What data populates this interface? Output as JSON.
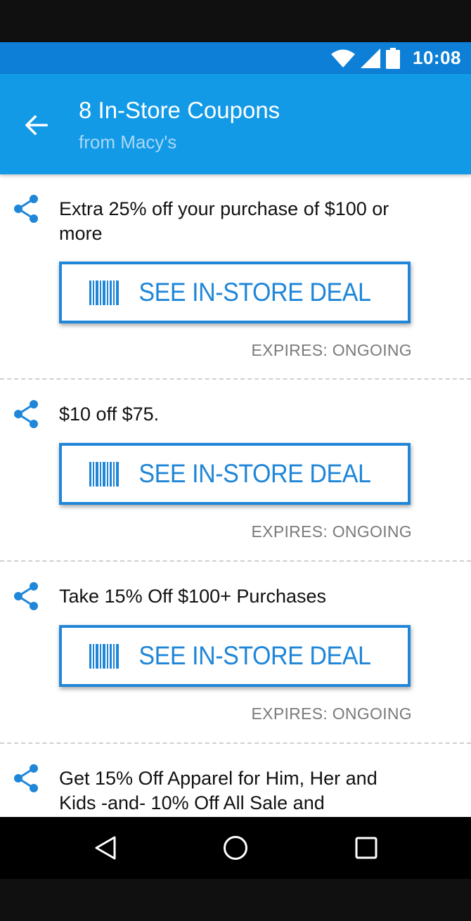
{
  "status_bar": {
    "time": "10:08"
  },
  "app_bar": {
    "title": "8 In-Store Coupons",
    "subtitle": "from Macy's"
  },
  "coupons": [
    {
      "description": "Extra 25% off your purchase of $100 or more",
      "button_label": "SEE IN-STORE DEAL",
      "expires": "EXPIRES: ONGOING"
    },
    {
      "description": "$10 off $75.",
      "button_label": "SEE IN-STORE DEAL",
      "expires": "EXPIRES: ONGOING"
    },
    {
      "description": "Take 15% Off $100+ Purchases",
      "button_label": "SEE IN-STORE DEAL",
      "expires": "EXPIRES: ONGOING"
    },
    {
      "description": "Get 15% Off Apparel for Him, Her and Kids -and- 10% Off All Sale and"
    }
  ],
  "colors": {
    "status_bar": "#0d7fd6",
    "app_bar": "#139ae7",
    "accent": "#1f86d8"
  },
  "icons": [
    "wifi-icon",
    "cell-signal-icon",
    "battery-icon",
    "back-arrow-icon",
    "share-icon",
    "barcode-icon",
    "nav-back-icon",
    "nav-home-icon",
    "nav-recents-icon"
  ]
}
